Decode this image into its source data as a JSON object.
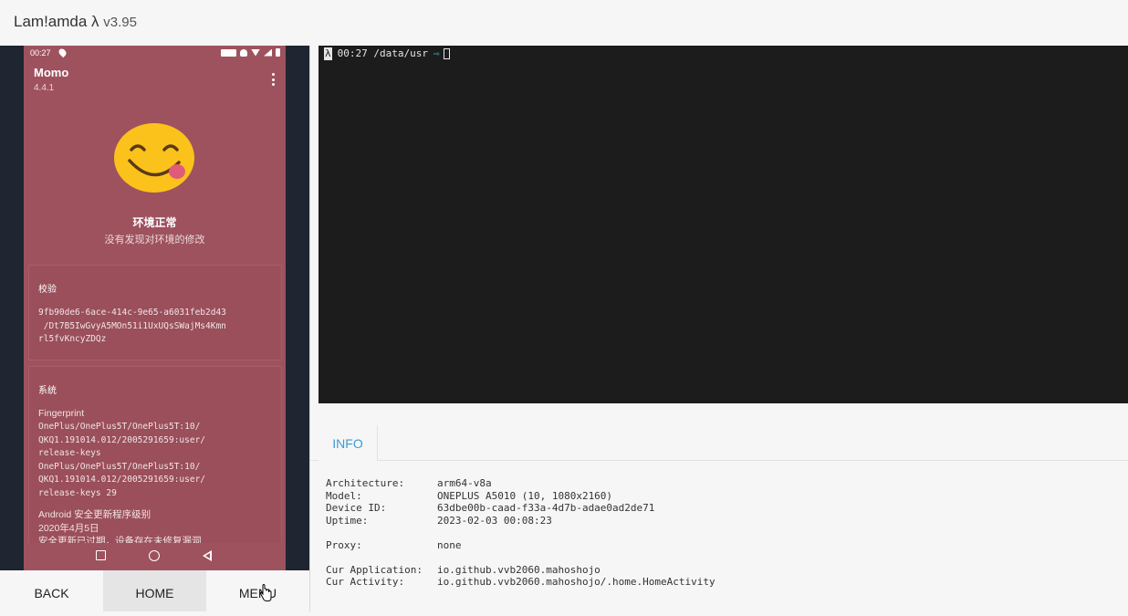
{
  "app": {
    "title": "Lam!amda λ",
    "version": "v3.95"
  },
  "device": {
    "status_time": "00:27",
    "app_name": "Momo",
    "app_version": "4.4.1",
    "status_title": "环境正常",
    "status_subtitle": "没有发现对环境的修改",
    "card_verify": {
      "title": "校验",
      "text": "9fb90de6-6ace-414c-9e65-a6031feb2d43\n /Dt7B5IwGvyA5MOn51i1UxUQsSWajMs4Kmn\nrl5fvKncyZDQz"
    },
    "card_system": {
      "title": "系统",
      "fingerprint_label": "Fingerprint",
      "fingerprint_value": "OnePlus/OnePlus5T/OnePlus5T:10/\nQKQ1.191014.012/2005291659:user/\nrelease-keys\nOnePlus/OnePlus5T/OnePlus5T:10/\nQKQ1.191014.012/2005291659:user/\nrelease-keys 29",
      "security_text": "Android 安全更新程序级别\n2020年4月5日\n安全更新已过期，设备存在未修复漏洞"
    }
  },
  "controls": {
    "back": "BACK",
    "home": "HOME",
    "menu": "MENU"
  },
  "terminal": {
    "prompt": "00:27 /data/usr",
    "lambda": "λ",
    "arrow": "⇨"
  },
  "info": {
    "tab": "INFO",
    "rows": [
      {
        "key": "Architecture:",
        "value": "arm64-v8a"
      },
      {
        "key": "Model:",
        "value": "ONEPLUS A5010 (10, 1080x2160)"
      },
      {
        "key": "Device ID:",
        "value": "63dbe00b-caad-f33a-4d7b-adae0ad2de71"
      },
      {
        "key": "Uptime:",
        "value": "2023-02-03 00:08:23"
      },
      {
        "key": "Proxy:",
        "value": "none"
      },
      {
        "key": "Cur Application:",
        "value": "io.github.vvb2060.mahoshojo"
      },
      {
        "key": "Cur Activity:",
        "value": "io.github.vvb2060.mahoshojo/.home.HomeActivity"
      }
    ]
  }
}
